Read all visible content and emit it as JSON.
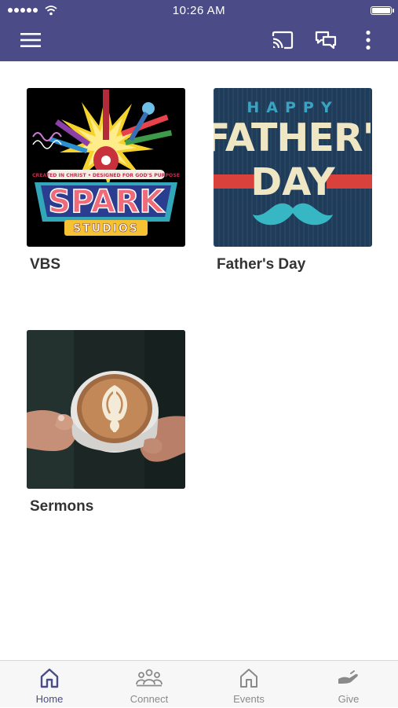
{
  "status_bar": {
    "time": "10:26 AM"
  },
  "colors": {
    "header": "#4b4c87",
    "background": "#ffffff",
    "tab_active": "#4b4c87",
    "tab_inactive": "#8a8a8a",
    "card_title": "#333333"
  },
  "header": {
    "icons": [
      "menu-icon",
      "cast-icon",
      "chat-icon",
      "more-vertical-icon"
    ]
  },
  "cards": [
    {
      "title": "VBS",
      "image": "spark-studios-artwork",
      "image_text": {
        "tagline": "CREATED IN CHRIST • DESIGNED FOR GOD'S PURPOSE",
        "word1": "SPARK",
        "word2": "STUDIOS"
      }
    },
    {
      "title": "Father's Day",
      "image": "happy-fathers-day-artwork",
      "image_text": {
        "line1": "HAPPY",
        "line2": "FATHER'S",
        "line3": "DAY"
      }
    },
    {
      "title": "Sermons",
      "image": "latte-cup-photo"
    }
  ],
  "tabs": [
    {
      "label": "Home",
      "icon": "home-icon",
      "active": true
    },
    {
      "label": "Connect",
      "icon": "group-icon",
      "active": false
    },
    {
      "label": "Events",
      "icon": "home-outline-icon",
      "active": false
    },
    {
      "label": "Give",
      "icon": "give-hand-icon",
      "active": false
    }
  ]
}
